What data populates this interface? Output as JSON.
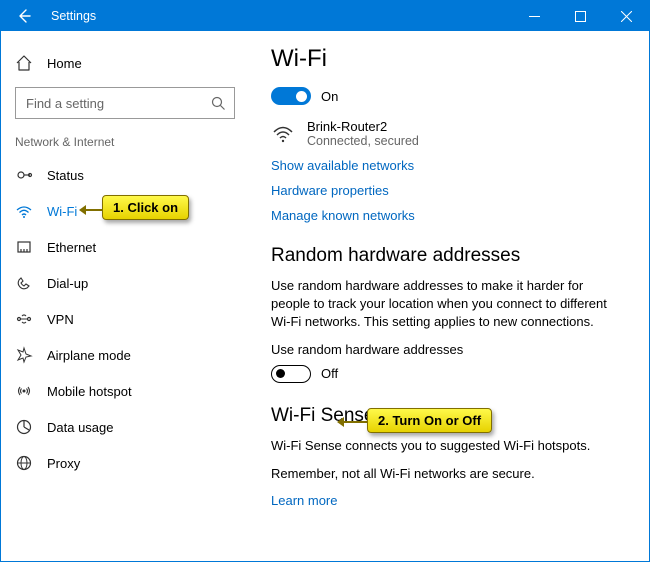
{
  "titlebar": {
    "title": "Settings"
  },
  "sidebar": {
    "home": "Home",
    "search_placeholder": "Find a setting",
    "section": "Network & Internet",
    "items": [
      {
        "label": "Status"
      },
      {
        "label": "Wi-Fi"
      },
      {
        "label": "Ethernet"
      },
      {
        "label": "Dial-up"
      },
      {
        "label": "VPN"
      },
      {
        "label": "Airplane mode"
      },
      {
        "label": "Mobile hotspot"
      },
      {
        "label": "Data usage"
      },
      {
        "label": "Proxy"
      }
    ]
  },
  "content": {
    "heading": "Wi-Fi",
    "wifi_toggle_state": "On",
    "network": {
      "ssid": "Brink-Router2",
      "status": "Connected, secured"
    },
    "links": {
      "show": "Show available networks",
      "hw": "Hardware properties",
      "known": "Manage known networks",
      "learn": "Learn more"
    },
    "rha": {
      "heading": "Random hardware addresses",
      "desc": "Use random hardware addresses to make it harder for people to track your location when you connect to different Wi-Fi networks. This setting applies to new connections.",
      "label": "Use random hardware addresses",
      "state": "Off"
    },
    "sense": {
      "heading": "Wi-Fi Sense",
      "p1": "Wi-Fi Sense connects you to suggested Wi-Fi hotspots.",
      "p2": "Remember, not all Wi-Fi networks are secure."
    }
  },
  "callouts": {
    "c1": "1. Click on",
    "c2": "2. Turn On or Off"
  }
}
